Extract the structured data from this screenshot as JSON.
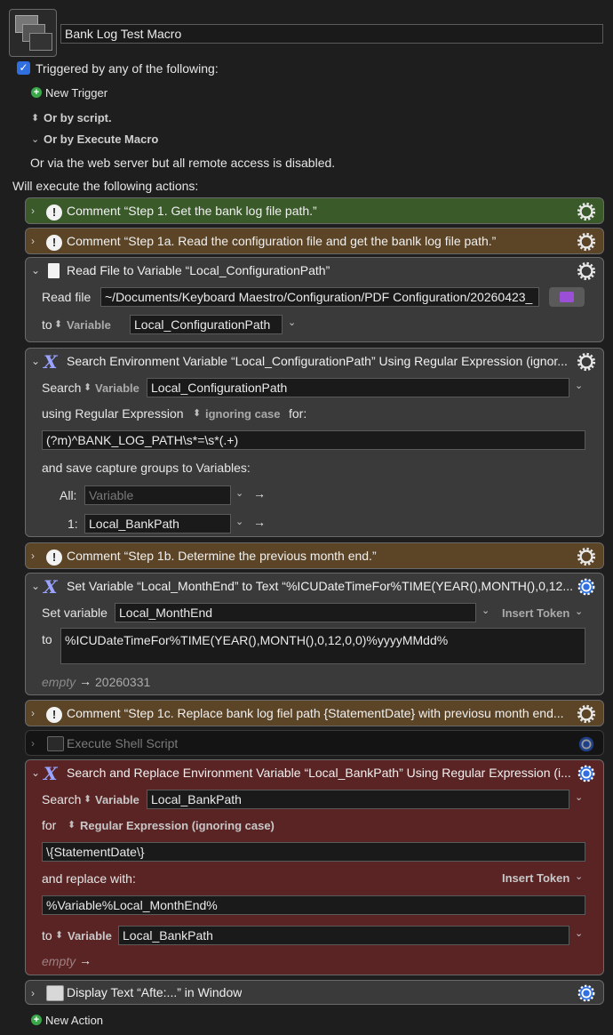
{
  "macro": {
    "name": "Bank Log Test Macro"
  },
  "triggers": {
    "checkbox_label": "Triggered by any of the following:",
    "new_trigger": "New Trigger",
    "by_script": "Or by script.",
    "by_execute_macro": "Or by Execute Macro",
    "web_server": "Or via the web server but all remote access is disabled."
  },
  "actions_heading": "Will execute the following actions:",
  "actions": {
    "a1": {
      "title": "Comment “Step 1. Get the bank log file path.”"
    },
    "a2": {
      "title": "Comment “Step 1a. Read the configuration file and get the banlk log file path.”"
    },
    "a3": {
      "title": "Read File to Variable “Local_ConfigurationPath”",
      "read_file_label": "Read file",
      "path": "~/Documents/Keyboard Maestro/Configuration/PDF Configuration/20260423_",
      "to_label": "to",
      "variable_label": "Variable",
      "variable": "Local_ConfigurationPath"
    },
    "a4": {
      "title": "Search Environment Variable “Local_ConfigurationPath” Using Regular Expression (ignor...",
      "search_label": "Search",
      "variable_label": "Variable",
      "variable": "Local_ConfigurationPath",
      "using_label": "using Regular Expression",
      "case_label": "ignoring case",
      "for_label": "for:",
      "regex": "(?m)^BANK_LOG_PATH\\s*=\\s*(.+)",
      "save_label": "and save capture groups to Variables:",
      "all_label": "All:",
      "all_placeholder": "Variable",
      "one_label": "1:",
      "one_value": "Local_BankPath"
    },
    "a5": {
      "title": "Comment “Step 1b. Determine the previous month end.”"
    },
    "a6": {
      "title": "Set Variable “Local_MonthEnd” to Text “%ICUDateTimeFor%TIME(YEAR(),MONTH(),0,12...",
      "set_label": "Set variable",
      "variable": "Local_MonthEnd",
      "insert_token": "Insert Token",
      "to_label": "to",
      "text": "%ICUDateTimeFor%TIME(YEAR(),MONTH(),0,12,0,0)%yyyyMMdd%",
      "empty_label": "empty",
      "result": "20260331"
    },
    "a7": {
      "title": "Comment “Step 1c. Replace bank log fiel path {StatementDate} with previosu month end..."
    },
    "a8": {
      "title": "Execute Shell Script"
    },
    "a9": {
      "title": "Search and Replace Environment Variable “Local_BankPath” Using Regular Expression (i...",
      "search_label": "Search",
      "variable_label": "Variable",
      "variable": "Local_BankPath",
      "for_label": "for",
      "mode": "Regular Expression (ignoring case)",
      "pattern": "\\{StatementDate\\}",
      "replace_label": "and replace with:",
      "insert_token": "Insert Token",
      "replacement": "%Variable%Local_MonthEnd%",
      "to_label": "to",
      "to_variable_label": "Variable",
      "to_variable": "Local_BankPath",
      "empty_label": "empty"
    },
    "a10": {
      "title": "Display Text “Afte:...” in Window"
    }
  },
  "new_action": "New Action",
  "colors": {
    "comment_green": "#3a5a2a",
    "comment_brown": "#5c4426",
    "action_gray": "#3a3a3a",
    "disabled_dark": "#141414",
    "replace_red": "#5a2424",
    "accent_blue": "#2f6fe0"
  }
}
